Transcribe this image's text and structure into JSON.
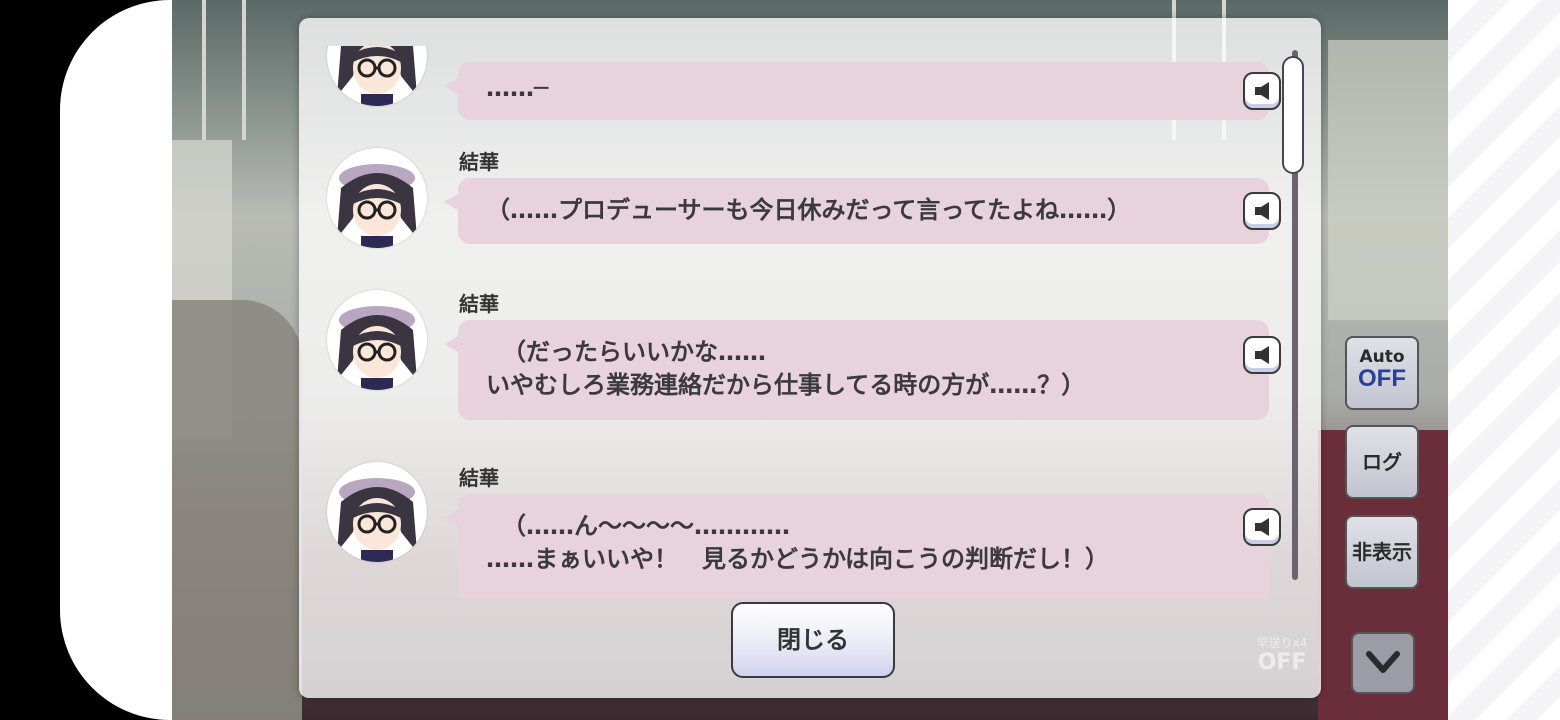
{
  "log_entries": [
    {
      "speaker": "",
      "lines": [
        "……─"
      ],
      "voice_icon": "speaker-icon"
    },
    {
      "speaker": "結華",
      "lines": [
        "（……プロデューサーも今日休みだって言ってたよね……）"
      ],
      "voice_icon": "speaker-icon"
    },
    {
      "speaker": "結華",
      "lines": [
        "（だったらいいかな……",
        "いやむしろ業務連絡だから仕事してる時の方が……？）"
      ],
      "voice_icon": "speaker-icon"
    },
    {
      "speaker": "結華",
      "lines": [
        "（……ん〜〜〜〜…………",
        "……まぁいいや！　見るかどうかは向こうの判断だし！）"
      ],
      "voice_icon": "speaker-icon"
    }
  ],
  "close_button": {
    "label": "閉じる"
  },
  "side_controls": {
    "auto_label": "Auto",
    "auto_state": "OFF",
    "log_label": "ログ",
    "hide_label": "非表示",
    "down_icon": "chevron-down-icon"
  },
  "fast_forward": {
    "label": "早送りx4",
    "state": "OFF"
  },
  "colors": {
    "bubble": "#e8d2dc",
    "auto_off": "#2a40a0"
  }
}
